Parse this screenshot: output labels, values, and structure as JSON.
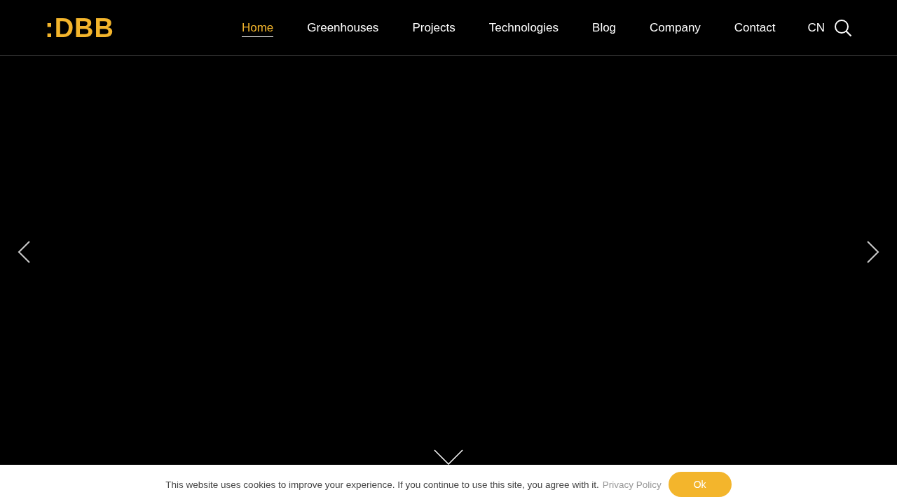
{
  "logo": {
    "text": ":DBB"
  },
  "nav": [
    {
      "label": "Home",
      "selected": true
    },
    {
      "label": "Greenhouses",
      "selected": false
    },
    {
      "label": "Projects",
      "selected": false
    },
    {
      "label": "Technologies",
      "selected": false
    },
    {
      "label": "Blog",
      "selected": false
    },
    {
      "label": "Company",
      "selected": false
    },
    {
      "label": "Contact",
      "selected": false
    }
  ],
  "language": "CN",
  "cookie_bar": {
    "message": "This website uses cookies to improve your experience. If you continue to use this site, you agree with it.",
    "link": "Privacy Policy",
    "button": "Ok"
  }
}
